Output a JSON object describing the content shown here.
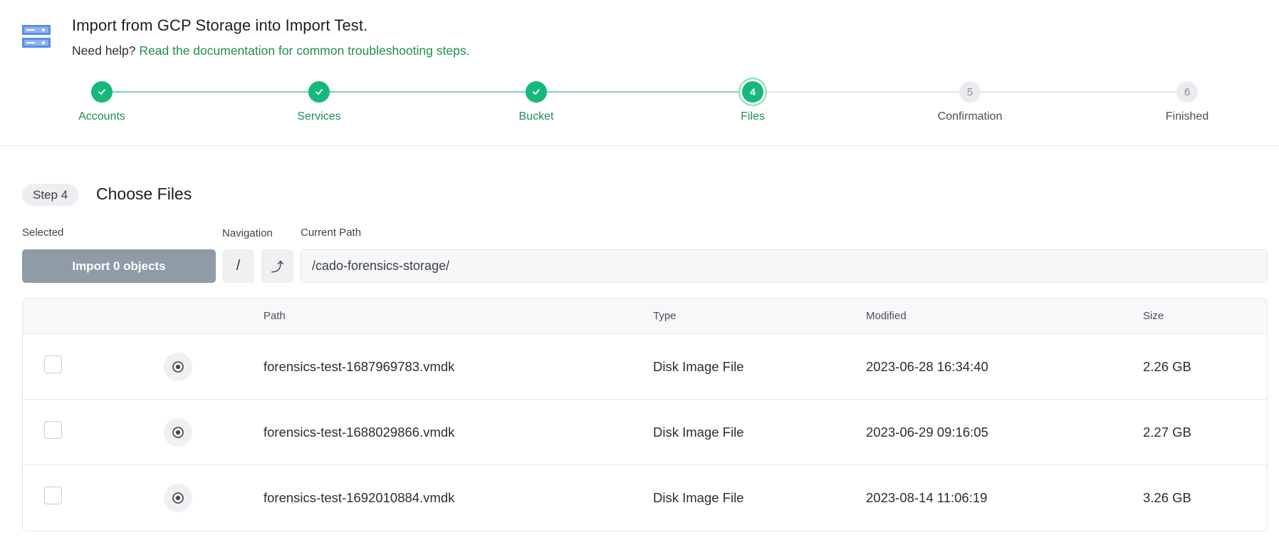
{
  "header": {
    "icon": "server-icon",
    "title": "Import from GCP Storage into Import Test.",
    "help_prefix": "Need help?",
    "help_link": "Read the documentation for common troubleshooting steps."
  },
  "stepper": {
    "steps": [
      {
        "label": "Accounts",
        "state": "done",
        "number": "1"
      },
      {
        "label": "Services",
        "state": "done",
        "number": "2"
      },
      {
        "label": "Bucket",
        "state": "done",
        "number": "3"
      },
      {
        "label": "Files",
        "state": "current",
        "number": "4"
      },
      {
        "label": "Confirmation",
        "state": "todo",
        "number": "5"
      },
      {
        "label": "Finished",
        "state": "todo",
        "number": "6"
      }
    ]
  },
  "step_header": {
    "badge": "Step 4",
    "title": "Choose Files"
  },
  "controls": {
    "selected_label": "Selected",
    "import_button": "Import 0 objects",
    "navigation_label": "Navigation",
    "root_button": "/",
    "up_button": "⤴",
    "path_label": "Current Path",
    "current_path": "/cado-forensics-storage/"
  },
  "table": {
    "columns": [
      "Path",
      "Type",
      "Modified",
      "Size"
    ],
    "rows": [
      {
        "path": "forensics-test-1687969783.vmdk",
        "type": "Disk Image File",
        "modified": "2023-06-28 16:34:40",
        "size": "2.26 GB"
      },
      {
        "path": "forensics-test-1688029866.vmdk",
        "type": "Disk Image File",
        "modified": "2023-06-29 09:16:05",
        "size": "2.27 GB"
      },
      {
        "path": "forensics-test-1692010884.vmdk",
        "type": "Disk Image File",
        "modified": "2023-08-14 11:06:19",
        "size": "3.26 GB"
      }
    ]
  },
  "colors": {
    "accent": "#16b97a",
    "link": "#1e8e52",
    "disabled_button": "#8f9ba6"
  }
}
